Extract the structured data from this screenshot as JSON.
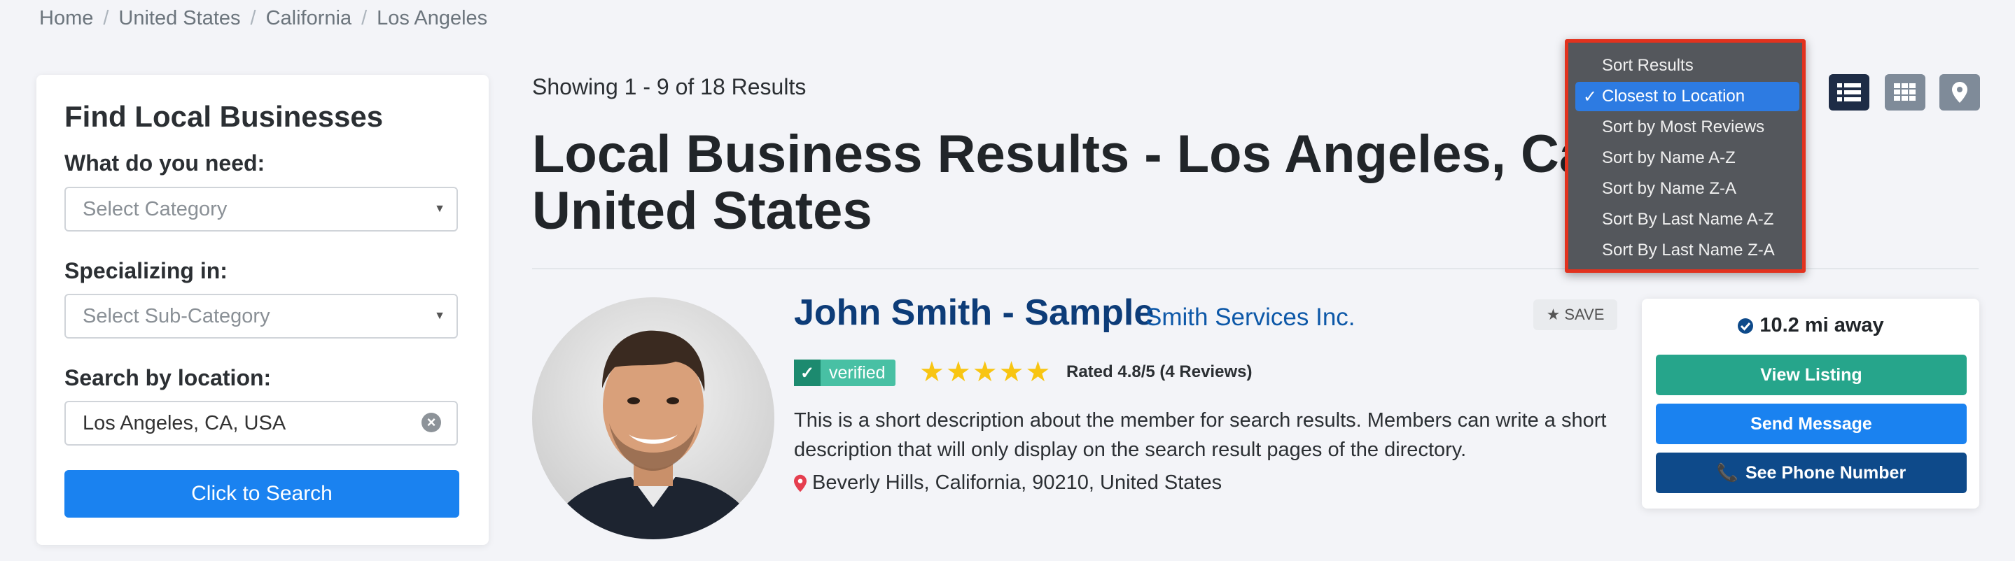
{
  "breadcrumb": [
    "Home",
    "United States",
    "California",
    "Los Angeles"
  ],
  "sidebar": {
    "title": "Find Local Businesses",
    "category_label": "What do you need:",
    "category_placeholder": "Select Category",
    "subcategory_label": "Specializing in:",
    "subcategory_placeholder": "Select Sub-Category",
    "location_label": "Search by location:",
    "location_value": "Los Angeles, CA, USA",
    "search_button": "Click to Search"
  },
  "results": {
    "showing": "Showing 1 - 9 of 18 Results",
    "title": "Local Business Results - Los Angeles, California, United States"
  },
  "sort_menu": {
    "items": [
      "Sort Results",
      "Closest to Location",
      "Sort by Most Reviews",
      "Sort by Name A-Z",
      "Sort by Name Z-A",
      "Sort By Last Name A-Z",
      "Sort By Last Name Z-A"
    ],
    "selected": "Closest to Location"
  },
  "view_buttons": [
    "list-view-icon",
    "grid-view-icon",
    "map-pin-icon"
  ],
  "listing": {
    "name": "John Smith - Sample",
    "company": "Smith Services Inc.",
    "save_label": "SAVE",
    "verified_label": "verified",
    "rating_stars": 5,
    "rating_text": "Rated 4.8/5 (4 Reviews)",
    "description": "This is a short description about the member for search results. Members can write a short description that will only display on the search result pages of the directory.",
    "location": "Beverly Hills, California, 90210, United States",
    "distance": "10.2 mi away",
    "view_listing": "View Listing",
    "send_message": "Send Message",
    "see_phone": "See Phone Number"
  },
  "colors": {
    "primary": "#1a82f0",
    "teal": "#26a58b",
    "navy": "#0e4a8a",
    "dropdown_bg": "#54575c",
    "highlight_border": "#e2321e",
    "star": "#f8c512"
  }
}
